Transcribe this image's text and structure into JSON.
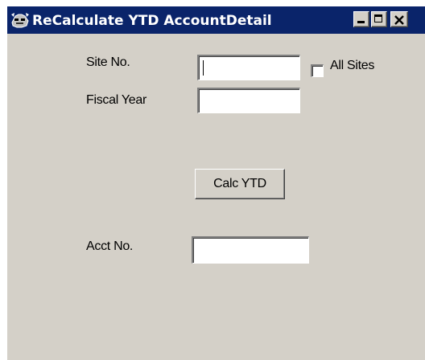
{
  "window": {
    "title": "ReCalculate YTD AccountDetail",
    "icon": "app-icon",
    "controls": {
      "minimize_icon": "minimize-icon",
      "maximize_icon": "maximize-icon",
      "close_icon": "close-icon"
    }
  },
  "form": {
    "site_no": {
      "label": "Site No.",
      "value": ""
    },
    "all_sites": {
      "label": "All Sites",
      "checked": false
    },
    "fiscal_year": {
      "label": "Fiscal Year",
      "value": ""
    },
    "calc_button": {
      "label": "Calc YTD"
    },
    "acct_no": {
      "label": "Acct No.",
      "value": ""
    }
  },
  "colors": {
    "titlebar": "#0a246a",
    "face": "#d4d0c8",
    "title_text": "#ffffff"
  }
}
